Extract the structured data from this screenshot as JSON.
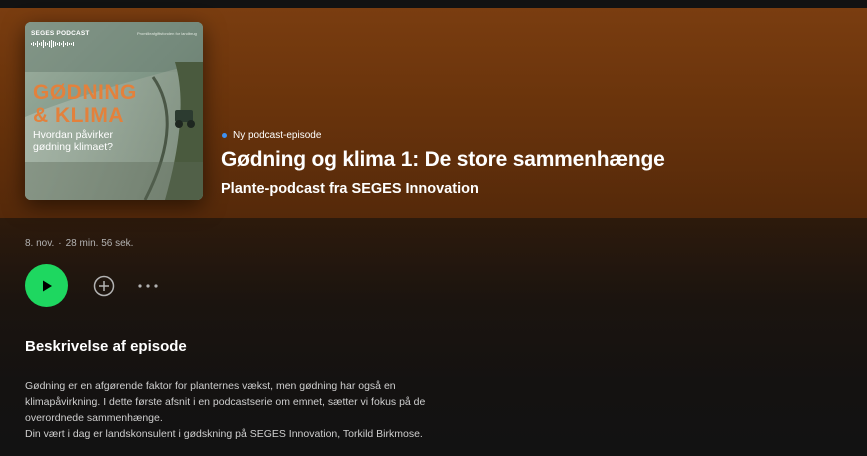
{
  "cover": {
    "podcast_label": "SEGES PODCAST",
    "partner_text": "Promilleafgiftsfonden for landbrug",
    "title_line1": "GØDNING",
    "title_line2": "& KLIMA",
    "subtitle": "Hvordan påvirker\ngødning klimaet?",
    "accent_color": "#e3813c"
  },
  "episode": {
    "badge": "Ny podcast-episode",
    "title": "Gødning og klima 1: De store sammenhænge",
    "show": "Plante-podcast fra SEGES Innovation",
    "date": "8. nov.",
    "separator": "·",
    "duration": "28 min. 56 sek."
  },
  "actions": {
    "play_icon": "play-icon",
    "add_icon": "plus-circle-icon",
    "more_icon": "more-dots-icon",
    "play_color": "#1ed760"
  },
  "description": {
    "heading": "Beskrivelse af episode",
    "lines": [
      "Gødning er en afgørende faktor for planternes vækst, men gødning har også en",
      "klimapåvirkning. I dette første afsnit i en podcastserie om emnet, sætter vi fokus på de",
      "overordnede sammenhænge.",
      "Din vært i dag er landskonsulent i gødskning på SEGES Innovation, Torkild Birkmose."
    ]
  }
}
